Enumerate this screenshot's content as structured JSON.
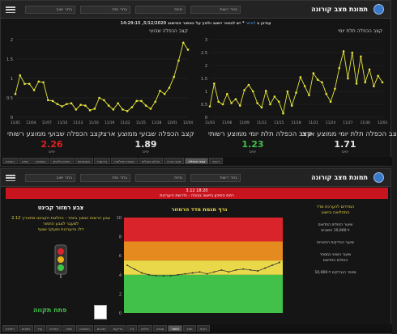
{
  "app": {
    "title": "תמונת מצב קורונה"
  },
  "panel1": {
    "filters": [
      "בחר ישוב",
      "בחר נפה",
      "מחוז",
      "בחר רשות"
    ],
    "subtitle_prefix": "14:29:15 ,5/12/2020 עודכן ב",
    "subtitle_link": "לאתר",
    "subtitle_suffix": "* יש לבחור יישוב ולחץ על כפתור החישוב",
    "chart_left_title": "קצב הכפלה שבועי",
    "chart_right_title": "קצב הכפלה תלת יומי",
    "stats": [
      {
        "label": "קצב הכפלה שבועי ממוצע רשותי",
        "value": "2.26",
        "sub": "ימים",
        "color": "#e02020"
      },
      {
        "label": "קצב הכפלה שבועי ממוצע ארצי",
        "value": "1.89",
        "sub": "ימים",
        "color": "#e6e6e6"
      },
      {
        "label": "קצב הכפלה תלת יומי ממוצע רשותי",
        "value": "1.23",
        "sub": "ימים",
        "color": "#41c14a"
      },
      {
        "label": "קצב הכפלה תלת יומי ממוצע ארצי",
        "value": "1.71",
        "sub": "ימים",
        "color": "#e6e6e6"
      }
    ],
    "tabs": [
      "ראשי",
      "קצב הכפלה",
      "מצב נוכחי",
      "חולים פעילים",
      "מגמת תחלואה",
      "בדיקות",
      "מאומתים",
      "ניתוח גילאים",
      "השוואה",
      "מפה",
      "רשויות"
    ]
  },
  "panel2": {
    "alert_line1": "3.12 18:20",
    "alert_line2": "רמת הסיכון ביישוב גבוהה - נדרשת היערכות",
    "alert_line3": "הנחיות משרד הבריאות",
    "left_heading": "צבע רמזור קבינט",
    "left_text1": "צבע הרשות הנמוך ביותר - החלטת הקבינט מתאריך 2.12",
    "left_text2": "למעבר לצבע החמור",
    "left_text3": "דלג והיערכות ומעקב שוטף",
    "status_label": "פתח תקווה",
    "chart_title": "גרף מגמת מדד הרמזור",
    "right_heading": "המדדים להערכת מדד",
    "right_heading2": "התחלואה ביישוב",
    "right_lines": [
      "שיעור החולים החדשים",
      "ל-10,000 תושבים",
      "שיעור הבדיקות החיוביות",
      "שיעור השינוי במספר",
      "החולים החדשים",
      "מספר הנבדקים ל-10,000"
    ],
    "tabs": [
      "ראשי",
      "מצב",
      "רמזור",
      "מגמה",
      "חולים",
      "גיל",
      "בדיקות",
      "ישובים",
      "השוואה",
      "מפה",
      "אזורים",
      "עוד",
      "נתונים",
      "רשויות"
    ]
  },
  "colors": {
    "accent": "#e6e63a",
    "alert": "#c8141e",
    "green": "#41c14a",
    "yellow": "#e9d94a",
    "orange": "#e58a1e",
    "red": "#d8242a"
  },
  "chart_data": [
    {
      "type": "line",
      "title": "קצב הכפלה שבועי",
      "x": [
        "11/01",
        "11/04",
        "11/07",
        "11/10",
        "11/13",
        "11/16",
        "11/19",
        "11/22",
        "11/25",
        "11/28",
        "12/01",
        "12/04"
      ],
      "ylim": [
        0,
        2
      ],
      "series": [
        {
          "values": [
            0.6,
            1.08,
            0.86,
            0.86,
            0.7,
            0.92,
            0.9,
            0.44,
            0.42,
            0.34,
            0.28,
            0.34,
            0.36,
            0.2,
            0.32,
            0.3,
            0.18,
            0.22,
            0.5,
            0.44,
            0.3,
            0.2,
            0.36,
            0.2,
            0.16,
            0.26,
            0.42,
            0.42,
            0.3,
            0.22,
            0.4,
            0.68,
            0.6,
            0.76,
            1.04,
            1.46,
            1.92,
            1.74
          ]
        }
      ]
    },
    {
      "type": "line",
      "title": "קצב הכפלה תלת יומי",
      "x": [
        "11/03",
        "11/06",
        "11/09",
        "11/12",
        "11/15",
        "11/18",
        "11/21",
        "11/24",
        "11/27",
        "11/30",
        "12/03"
      ],
      "ylim": [
        0,
        3
      ],
      "series": [
        {
          "values": [
            0.42,
            1.3,
            0.6,
            0.5,
            0.9,
            0.55,
            0.7,
            0.45,
            1.05,
            1.25,
            1.0,
            0.55,
            0.38,
            1.02,
            0.5,
            0.8,
            0.6,
            0.15,
            1.0,
            0.45,
            0.95,
            1.55,
            1.2,
            0.85,
            1.7,
            1.45,
            1.35,
            0.9,
            0.6,
            1.1,
            1.9,
            2.55,
            1.5,
            2.5,
            1.3,
            2.35,
            1.35,
            1.85,
            1.2,
            1.6,
            1.35
          ]
        }
      ]
    },
    {
      "type": "line",
      "title": "גרף מגמת מדד הרמזור",
      "ylim": [
        0,
        10
      ],
      "series": [
        {
          "values": [
            5.0,
            4.6,
            4.2,
            4.0,
            3.9,
            3.9,
            3.9,
            4.0,
            4.1,
            4.2,
            4.3,
            4.1,
            4.3,
            4.5,
            4.3,
            4.5,
            4.6,
            4.5,
            4.4,
            4.7,
            5.0,
            5.3
          ]
        }
      ]
    }
  ]
}
